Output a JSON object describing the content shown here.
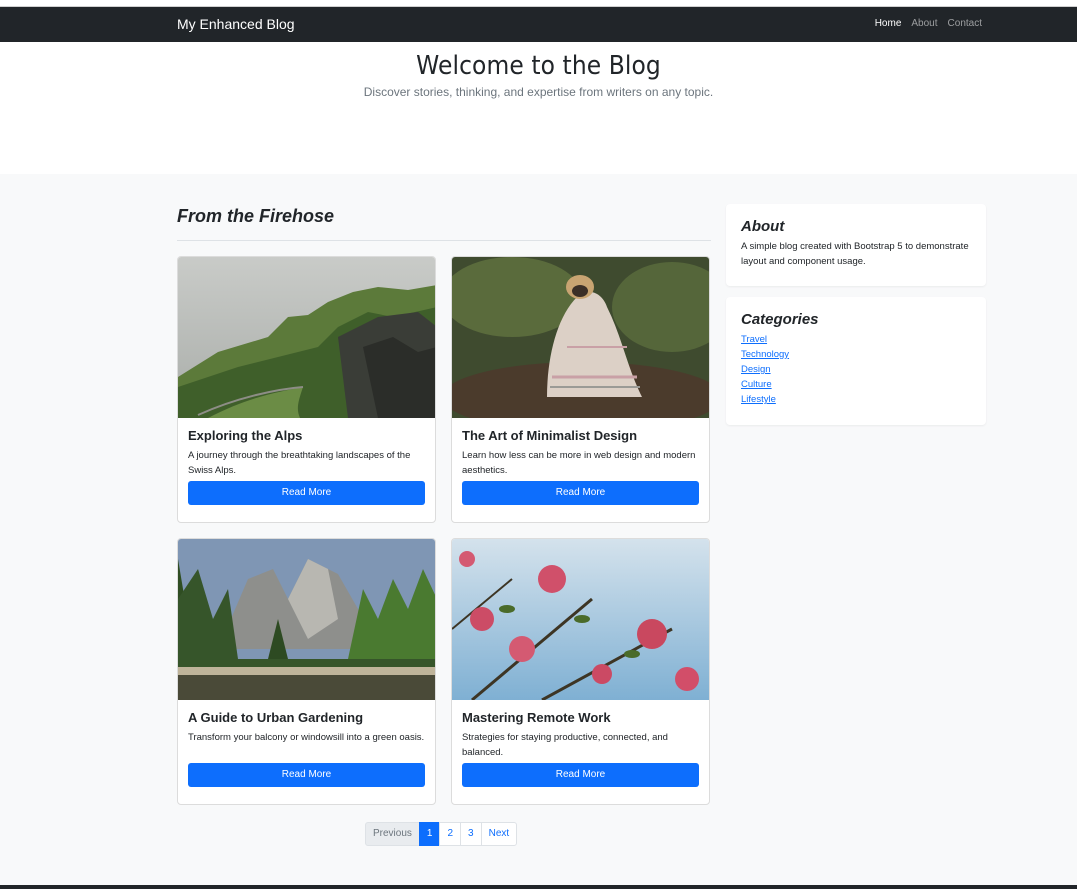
{
  "navbar": {
    "brand": "My Enhanced Blog",
    "links": [
      {
        "label": "Home",
        "active": true
      },
      {
        "label": "About",
        "active": false
      },
      {
        "label": "Contact",
        "active": false
      }
    ]
  },
  "hero": {
    "title": "Welcome to the Blog",
    "subtitle": "Discover stories, thinking, and expertise from writers on any topic."
  },
  "main": {
    "section_title": "From the Firehose",
    "posts": [
      {
        "title": "Exploring the Alps",
        "text": "A journey through the breathtaking landscapes of the Swiss Alps.",
        "button": "Read More",
        "image": "mountain-landscape"
      },
      {
        "title": "The Art of Minimalist Design",
        "text": "Learn how less can be more in web design and modern aesthetics.",
        "button": "Read More",
        "image": "pug-in-blanket"
      },
      {
        "title": "A Guide to Urban Gardening",
        "text": "Transform your balcony or windowsill into a green oasis.",
        "button": "Read More",
        "image": "yosemite-forest-river"
      },
      {
        "title": "Mastering Remote Work",
        "text": "Strategies for staying productive, connected, and balanced.",
        "button": "Read More",
        "image": "pink-flowers-sky"
      }
    ],
    "pagination": {
      "previous": "Previous",
      "pages": [
        "1",
        "2",
        "3"
      ],
      "active_page": "1",
      "next": "Next"
    }
  },
  "sidebar": {
    "about": {
      "title": "About",
      "text": "A simple blog created with Bootstrap 5 to demonstrate layout and component usage."
    },
    "categories": {
      "title": "Categories",
      "items": [
        "Travel",
        "Technology",
        "Design",
        "Culture",
        "Lifestyle"
      ]
    }
  },
  "colors": {
    "navbar_bg": "#212529",
    "primary": "#0d6efd",
    "page_bg": "#f8f9fa"
  }
}
